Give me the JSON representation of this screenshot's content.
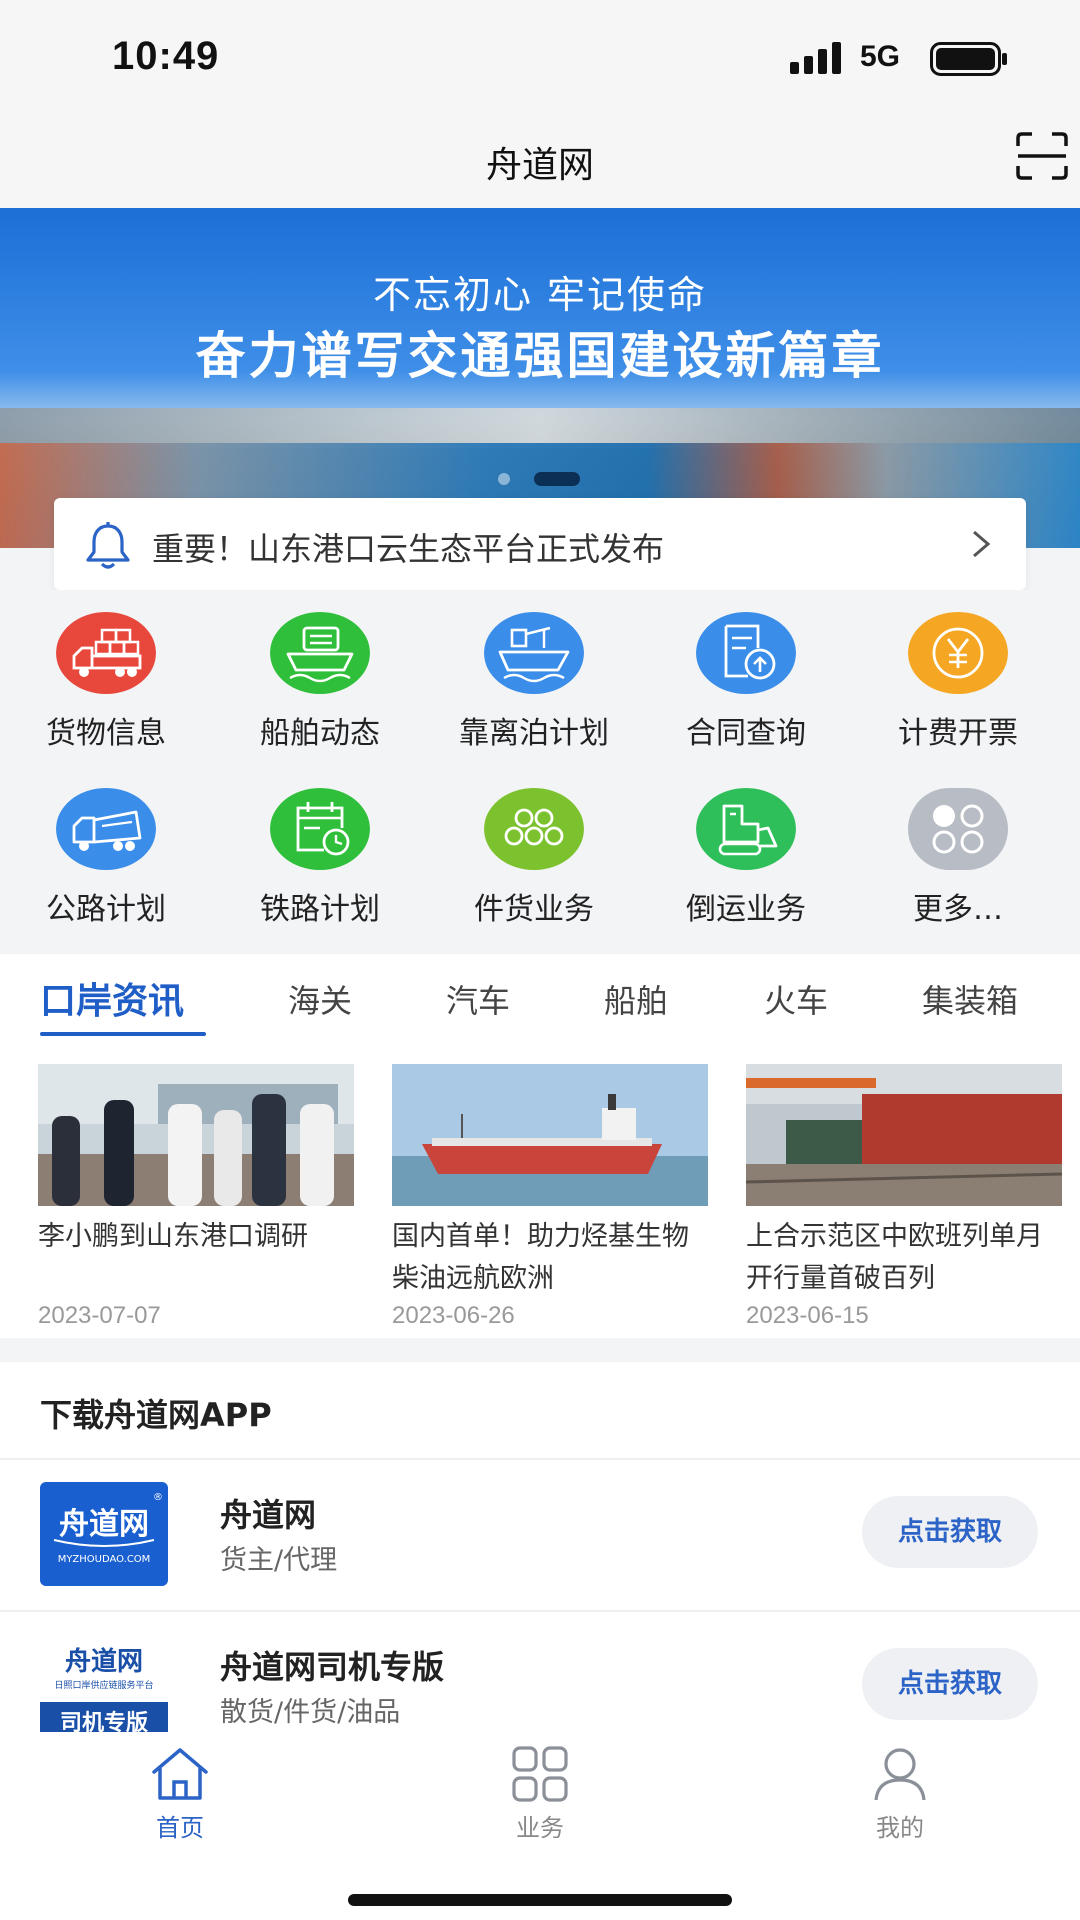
{
  "status_bar": {
    "time": "10:49",
    "network": "5G"
  },
  "nav": {
    "title": "舟道网"
  },
  "banner": {
    "line1": "不忘初心 牢记使命",
    "line2": "奋力谱写交通强国建设新篇章",
    "slide_count": 2,
    "active_slide": 2
  },
  "notice": {
    "text": "重要！山东港口云生态平台正式发布"
  },
  "services": [
    {
      "label": "货物信息",
      "icon": "cargo-truck-icon",
      "color": "#e8483c"
    },
    {
      "label": "船舶动态",
      "icon": "ship-icon",
      "color": "#2fbf3b"
    },
    {
      "label": "靠离泊计划",
      "icon": "berth-ship-icon",
      "color": "#3a8de8"
    },
    {
      "label": "合同查询",
      "icon": "contract-icon",
      "color": "#3a8de8"
    },
    {
      "label": "计费开票",
      "icon": "yen-icon",
      "color": "#f5a623"
    },
    {
      "label": "公路计划",
      "icon": "road-truck-icon",
      "color": "#3a8de8"
    },
    {
      "label": "铁路计划",
      "icon": "calendar-clock-icon",
      "color": "#2fbf3b"
    },
    {
      "label": "件货业务",
      "icon": "pipes-icon",
      "color": "#7cc22e"
    },
    {
      "label": "倒运业务",
      "icon": "bulldozer-icon",
      "color": "#2fbf5a"
    },
    {
      "label": "更多…",
      "icon": "more-grid-icon",
      "color": "#b8bcc4"
    }
  ],
  "news": {
    "tabs": [
      "口岸资讯",
      "海关",
      "汽车",
      "船舶",
      "火车",
      "集装箱"
    ],
    "active_tab": "口岸资讯",
    "items": [
      {
        "title": "李小鹏到山东港口调研",
        "date": "2023-07-07"
      },
      {
        "title": "国内首单！助力烃基生物柴油远航欧洲",
        "date": "2023-06-26"
      },
      {
        "title": "上合示范区中欧班列单月开行量首破百列",
        "date": "2023-06-15"
      }
    ]
  },
  "download": {
    "title": "下载舟道网APP",
    "apps": [
      {
        "name": "舟道网",
        "sub": "货主/代理",
        "button": "点击获取",
        "logo_text": "舟道网",
        "logo_sub": "MYZHOUDAO.COM"
      },
      {
        "name": "舟道网司机专版",
        "sub": "散货/件货/油品",
        "button": "点击获取",
        "logo_text": "舟道网",
        "logo_sub": "日照口岸供应链服务平台",
        "logo_badge": "司机专版"
      }
    ]
  },
  "tab_bar": {
    "items": [
      {
        "label": "首页",
        "icon": "home-icon",
        "active": true
      },
      {
        "label": "业务",
        "icon": "apps-grid-icon",
        "active": false
      },
      {
        "label": "我的",
        "icon": "user-icon",
        "active": false
      }
    ]
  },
  "colors": {
    "accent": "#1f5ec7",
    "button_text": "#2b63c6",
    "background": "#f3f4f6"
  }
}
